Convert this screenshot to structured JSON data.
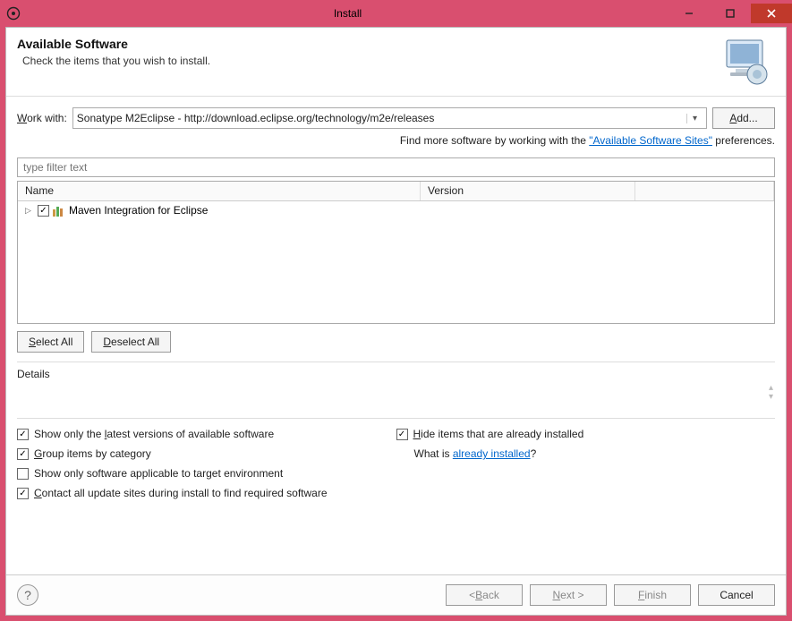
{
  "title": "Install",
  "banner": {
    "title": "Available Software",
    "subtitle": "Check the items that you wish to install."
  },
  "work_with": {
    "label": "Work with:",
    "value": "Sonatype M2Eclipse - http://download.eclipse.org/technology/m2e/releases",
    "add_label": "Add..."
  },
  "hint": {
    "prefix": "Find more software by working with the ",
    "link": "\"Available Software Sites\"",
    "suffix": " preferences."
  },
  "filter_placeholder": "type filter text",
  "columns": {
    "name": "Name",
    "version": "Version"
  },
  "items": [
    {
      "label": "Maven Integration for Eclipse",
      "checked": true
    }
  ],
  "select_all": "Select All",
  "deselect_all": "Deselect All",
  "details_label": "Details",
  "options": {
    "show_latest": {
      "label": "Show only the latest versions of available software",
      "checked": true
    },
    "group_category": {
      "label": "Group items by category",
      "checked": true
    },
    "show_applicable": {
      "label": "Show only software applicable to target environment",
      "checked": false
    },
    "contact_sites": {
      "label": "Contact all update sites during install to find required software",
      "checked": true
    },
    "hide_installed": {
      "label": "Hide items that are already installed",
      "checked": true
    },
    "what_is": {
      "prefix": "What is ",
      "link": "already installed",
      "suffix": "?"
    }
  },
  "footer": {
    "back": "< Back",
    "next": "Next >",
    "finish": "Finish",
    "cancel": "Cancel"
  }
}
